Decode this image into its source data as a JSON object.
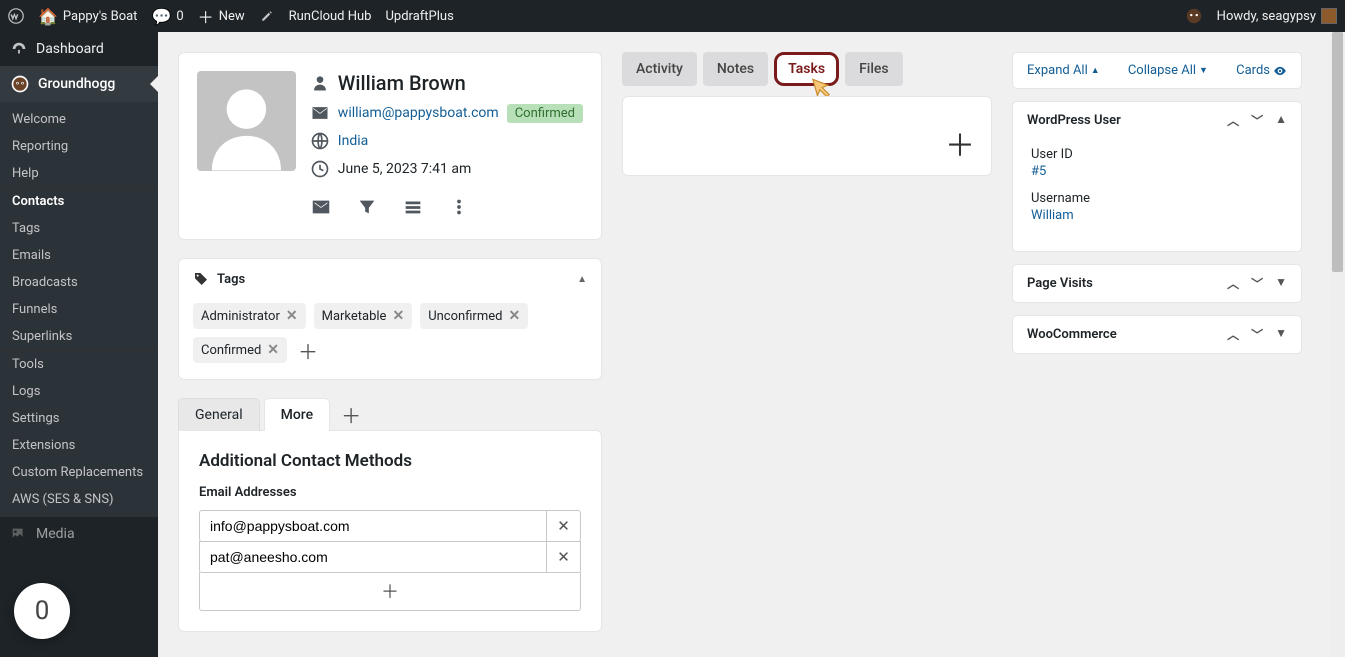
{
  "adminbar": {
    "site_name": "Pappy's Boat",
    "comments": "0",
    "new": "New",
    "links": [
      "RunCloud Hub",
      "UpdraftPlus"
    ],
    "howdy": "Howdy, seagypsy"
  },
  "sidebar": {
    "dashboard": "Dashboard",
    "active": "Groundhogg",
    "sub": [
      "Welcome",
      "Reporting",
      "Help",
      "Contacts",
      "Tags",
      "Emails",
      "Broadcasts",
      "Funnels",
      "Superlinks",
      "Tools",
      "Logs",
      "Settings",
      "Extensions",
      "Custom Replacements",
      "AWS (SES & SNS)"
    ],
    "media": "Media",
    "bubble": "0"
  },
  "profile": {
    "name": "William Brown",
    "email": "william@pappysboat.com",
    "status": "Confirmed",
    "location": "India",
    "date": "June 5, 2023 7:41 am"
  },
  "tags_section": {
    "title": "Tags",
    "tags": [
      "Administrator",
      "Marketable",
      "Unconfirmed",
      "Confirmed"
    ]
  },
  "detail_tabs": {
    "general": "General",
    "more": "More"
  },
  "contact_methods": {
    "title": "Additional Contact Methods",
    "emails_label": "Email Addresses",
    "emails": [
      "info@pappysboat.com",
      "pat@aneesho.com"
    ]
  },
  "mid_tabs": [
    "Activity",
    "Notes",
    "Tasks",
    "Files"
  ],
  "right": {
    "expand": "Expand All",
    "collapse": "Collapse All",
    "cards": "Cards",
    "wp_user_title": "WordPress User",
    "user_id_label": "User ID",
    "user_id": "#5",
    "username_label": "Username",
    "username": "William",
    "page_visits": "Page Visits",
    "woocommerce": "WooCommerce"
  }
}
